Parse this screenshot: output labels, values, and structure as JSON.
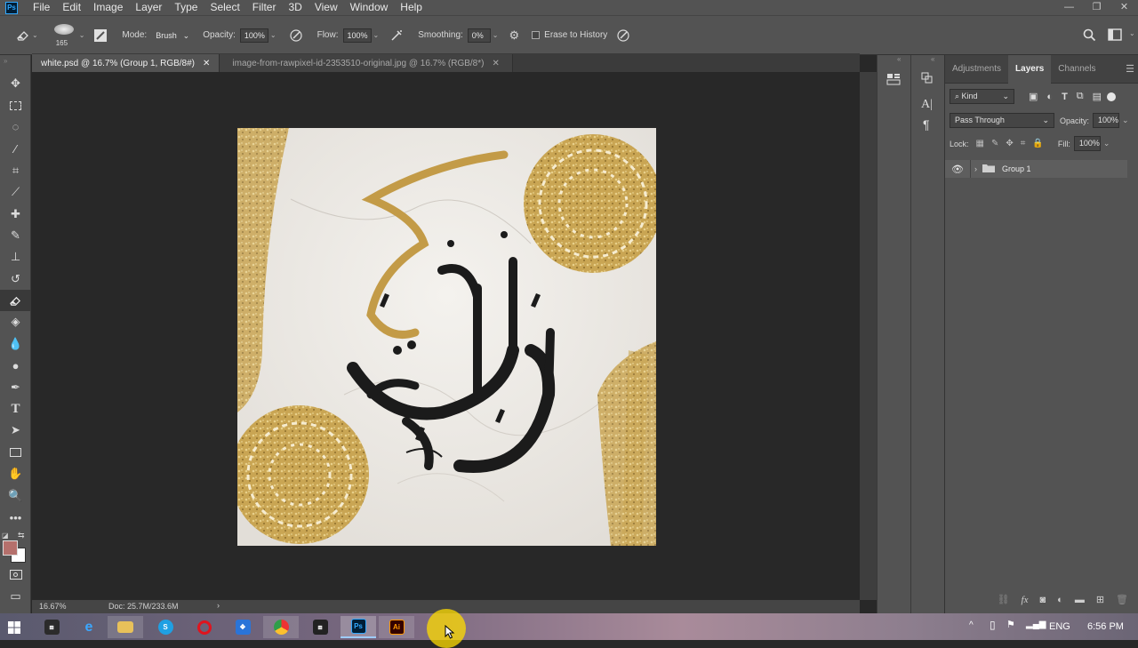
{
  "menubar": {
    "logo": "Ps",
    "items": [
      "File",
      "Edit",
      "Image",
      "Layer",
      "Type",
      "Select",
      "Filter",
      "3D",
      "View",
      "Window",
      "Help"
    ],
    "window_controls": [
      "—",
      "❐",
      "✕"
    ]
  },
  "options": {
    "brush_size": "165",
    "mode_label": "Mode:",
    "mode_value": "Brush",
    "opacity_label": "Opacity:",
    "opacity_value": "100%",
    "flow_label": "Flow:",
    "flow_value": "100%",
    "smoothing_label": "Smoothing:",
    "smoothing_value": "0%",
    "erase_history_label": "Erase to History"
  },
  "tabs": [
    {
      "label": "white.psd @ 16.7% (Group 1, RGB/8#)",
      "active": true
    },
    {
      "label": "image-from-rawpixel-id-2353510-original.jpg @ 16.7% (RGB/8*)",
      "active": false
    }
  ],
  "status": {
    "zoom": "16.67%",
    "doc": "Doc: 25.7M/233.6M"
  },
  "panel": {
    "tabs": [
      "Adjustments",
      "Layers",
      "Channels"
    ],
    "active_tab": "Layers",
    "kind_label": "Kind",
    "blend_mode": "Pass Through",
    "opacity_label": "Opacity:",
    "opacity_value": "100%",
    "lock_label": "Lock:",
    "fill_label": "Fill:",
    "fill_value": "100%",
    "layers": [
      {
        "name": "Group 1",
        "visible": true,
        "type": "group"
      }
    ]
  },
  "taskbar": {
    "lang": "ENG",
    "time": "6:56 PM"
  },
  "colors": {
    "foreground": "#b5706c",
    "background": "#ffffff",
    "gold": "#c9a553",
    "ink": "#1b1b1b"
  }
}
